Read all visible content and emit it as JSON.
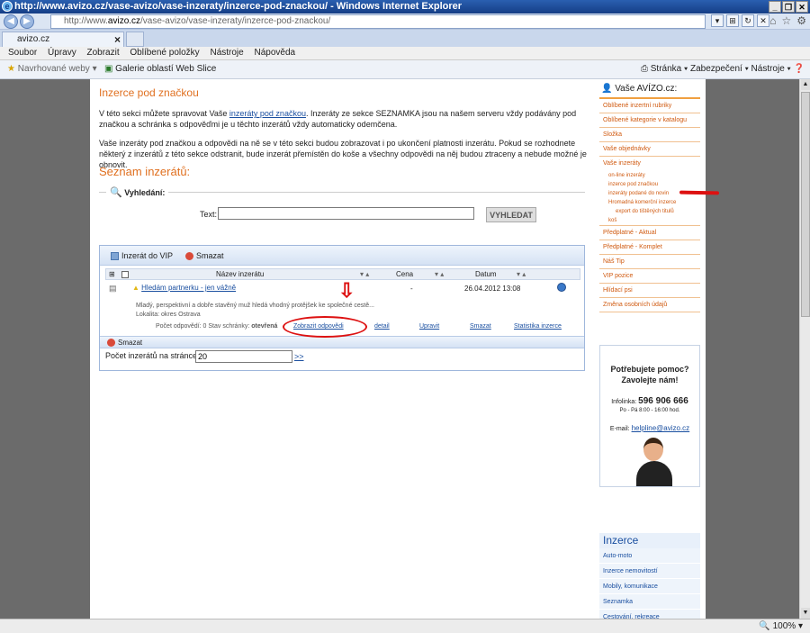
{
  "browser": {
    "window_title": "http://www.avizo.cz/vase-avizo/vase-inzeraty/inzerce-pod-znackou/ - Windows Internet Explorer",
    "address_prefix": "http://www.",
    "address_domain": "avizo.cz",
    "address_path": "/vase-avizo/vase-inzeraty/inzerce-pod-znackou/",
    "tab_label": "avizo.cz",
    "menu": [
      "Soubor",
      "Úpravy",
      "Zobrazit",
      "Oblíbené položky",
      "Nástroje",
      "Nápověda"
    ],
    "fav_suggested": "Navrhované weby ▾",
    "fav_gallery": "Galerie oblastí Web Slice",
    "tools_right": "Stránka ▾  Zabezpečení ▾  Nástroje ▾",
    "zoom": "100% ▾"
  },
  "content": {
    "title": "Inzerce pod značkou",
    "p1_before": "V této sekci můžete spravovat Vaše ",
    "p1_link": "inzeráty pod značkou",
    "p1_after": ". Inzeráty ze sekce SEZNAMKA jsou na našem serveru vždy podávány pod značkou a schránka s odpověďmi je u těchto inzerátů vždy automaticky odemčena.",
    "p2": "Vaše inzeráty pod značkou a odpovědi na ně se v této sekci budou zobrazovat i po ukončení platnosti inzerátu. Pokud se rozhodnete některý z inzerátů z této sekce odstranit, bude inzerát přemístěn do koše a všechny odpovědi na něj budou ztraceny a nebude možné je obnovit.",
    "list_title": "Seznam inzerátů:",
    "search_legend": "Vyhledání:",
    "search_text_label": "Text:",
    "search_button": "VYHLEDAT"
  },
  "grid": {
    "btn_vip": "Inzerát do VIP",
    "btn_delete": "Smazat",
    "col_name": "Název inzerátu",
    "col_price": "Cena",
    "col_date": "Datum",
    "row": {
      "title": "Hledám partnerku - jen vážně",
      "price": "-",
      "date": "26.04.2012 13:08",
      "desc": "Mladý, perspektivní a dobře stavěný muž hledá vhodný protějšek ke společné cestě...",
      "location": "Lokalita: okres Ostrava",
      "meta_counts": "Počet odpovědí: 0 Stav schránky:",
      "meta_state": "otevřená",
      "act_show": "Zobrazit odpovědi",
      "act_detail": "detail",
      "act_edit": "Upravit",
      "act_delete": "Smazat",
      "act_stats": "Statistika inzerce"
    },
    "footer_delete": "Smazat",
    "per_page_label": "Počet inzerátů na stránce:",
    "per_page_value": "20",
    "per_page_go": ">>"
  },
  "sidebar": {
    "title": "Vaše AVÍZO.cz:",
    "items": [
      "Oblíbené inzertní rubriky",
      "Oblíbené kategorie v katalogu",
      "Složka",
      "Vaše objednávky",
      "Vaše inzeráty"
    ],
    "sub": [
      "on-line inzeráty",
      "inzerce pod značkou",
      "inzeráty podané do novin",
      "Hromadná komerční inzerce"
    ],
    "sub_deep": "export do tištěných titulů",
    "sub_trash": "koš",
    "items2": [
      "Předplatné - Aktual",
      "Předplatné - Komplet",
      "Náš Tip",
      "VIP pozice",
      "Hlídací psi",
      "Změna osobních údajů"
    ],
    "help_title_1": "Potřebujete pomoc?",
    "help_title_2": "Zavolejte nám!",
    "help_phone_label": "Infolinka:",
    "help_phone": "596 906 666",
    "help_hours": "Po - Pá 8:00 - 16:00 hod.",
    "help_email_label": "E-mail:",
    "help_email": "helpline@avizo.cz",
    "inz_title": "Inzerce",
    "inz_items": [
      "Auto-moto",
      "Inzerce nemovitostí",
      "Mobily, komunikace",
      "Seznamka",
      "Cestování, rekreace"
    ]
  }
}
